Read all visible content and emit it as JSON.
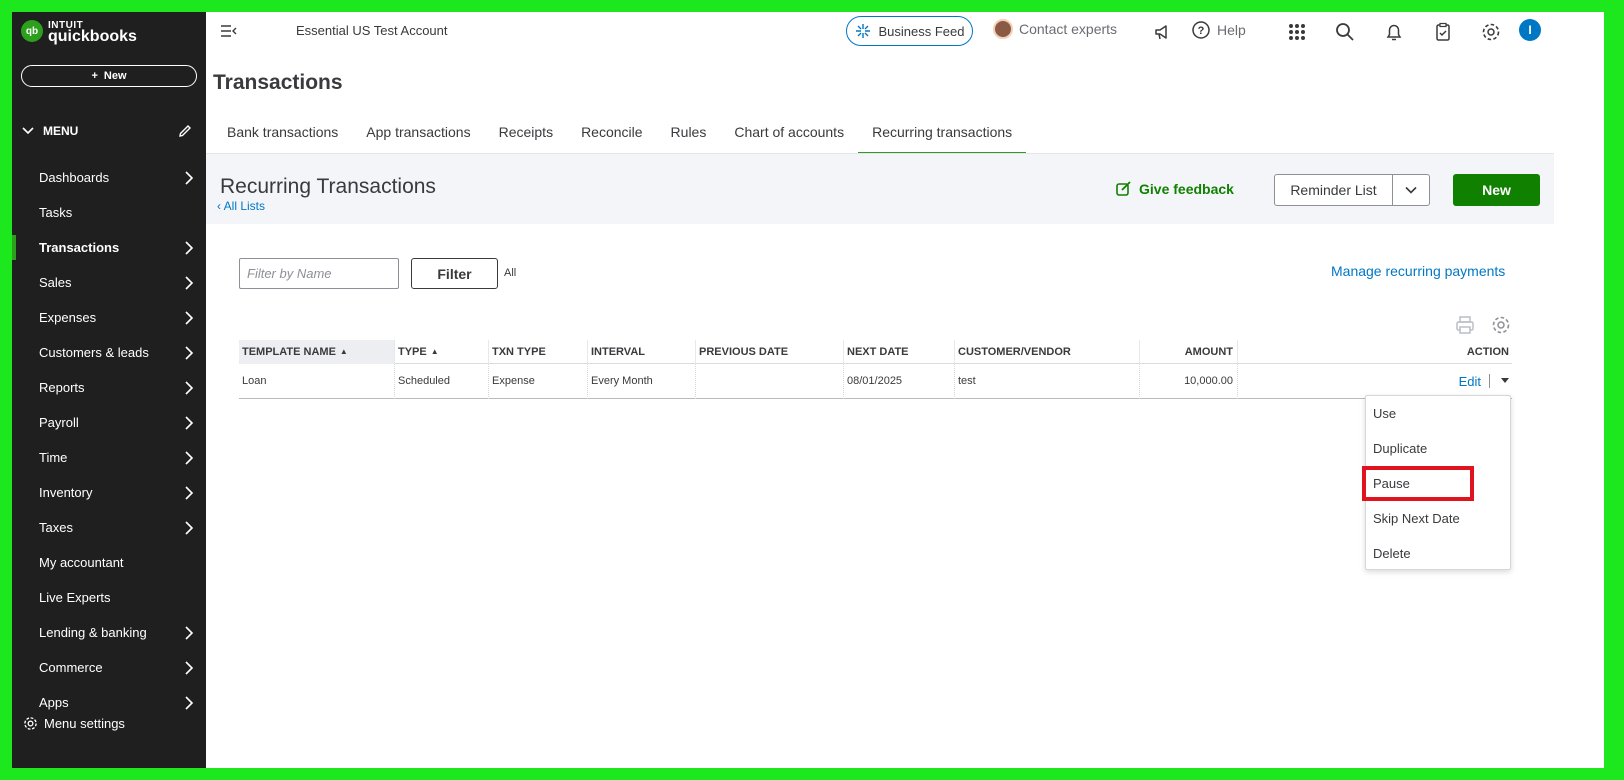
{
  "app": {
    "logo_top": "INTUIT",
    "logo_bottom": "quickbooks",
    "logo_mark": "qb",
    "new_button": "New",
    "company_name": "Essential US Test Account",
    "business_feed": "Business Feed",
    "contact_experts": "Contact experts",
    "help": "Help",
    "user_initial": "I"
  },
  "sidebar": {
    "menu_label": "MENU",
    "items": [
      {
        "label": "Dashboards",
        "has_chevron": true
      },
      {
        "label": "Tasks",
        "has_chevron": false
      },
      {
        "label": "Transactions",
        "has_chevron": true,
        "active": true
      },
      {
        "label": "Sales",
        "has_chevron": true
      },
      {
        "label": "Expenses",
        "has_chevron": true
      },
      {
        "label": "Customers & leads",
        "has_chevron": true
      },
      {
        "label": "Reports",
        "has_chevron": true
      },
      {
        "label": "Payroll",
        "has_chevron": true
      },
      {
        "label": "Time",
        "has_chevron": true
      },
      {
        "label": "Inventory",
        "has_chevron": true
      },
      {
        "label": "Taxes",
        "has_chevron": true
      },
      {
        "label": "My accountant",
        "has_chevron": false
      },
      {
        "label": "Live Experts",
        "has_chevron": false
      },
      {
        "label": "Lending & banking",
        "has_chevron": true
      },
      {
        "label": "Commerce",
        "has_chevron": true
      },
      {
        "label": "Apps",
        "has_chevron": true
      }
    ],
    "menu_settings": "Menu settings"
  },
  "page": {
    "title": "Transactions",
    "tabs": [
      "Bank transactions",
      "App transactions",
      "Receipts",
      "Reconcile",
      "Rules",
      "Chart of accounts",
      "Recurring transactions"
    ],
    "active_tab": "Recurring transactions",
    "section_title": "Recurring Transactions",
    "all_lists": "All Lists",
    "give_feedback": "Give feedback",
    "reminder_list": "Reminder List",
    "new_button": "New"
  },
  "filter": {
    "placeholder": "Filter by Name",
    "button": "Filter",
    "status": "All",
    "manage_link": "Manage recurring payments"
  },
  "table": {
    "headers": [
      "TEMPLATE NAME",
      "TYPE",
      "TXN TYPE",
      "INTERVAL",
      "PREVIOUS DATE",
      "NEXT DATE",
      "CUSTOMER/VENDOR",
      "AMOUNT",
      "ACTION"
    ],
    "rows": [
      {
        "template_name": "Loan",
        "type": "Scheduled",
        "txn_type": "Expense",
        "interval": "Every Month",
        "previous_date": "",
        "next_date": "08/01/2025",
        "customer_vendor": "test",
        "amount": "10,000.00",
        "action": "Edit"
      }
    ]
  },
  "action_menu": {
    "items": [
      "Use",
      "Duplicate",
      "Pause",
      "Skip Next Date",
      "Delete"
    ],
    "highlighted": "Pause"
  },
  "colors": {
    "frame": "#1de81d",
    "sidebar": "#1f1f1f",
    "brand_green": "#2ca01c",
    "button_green": "#108000",
    "link_blue": "#0077c5",
    "highlight_red": "#e0141e"
  }
}
